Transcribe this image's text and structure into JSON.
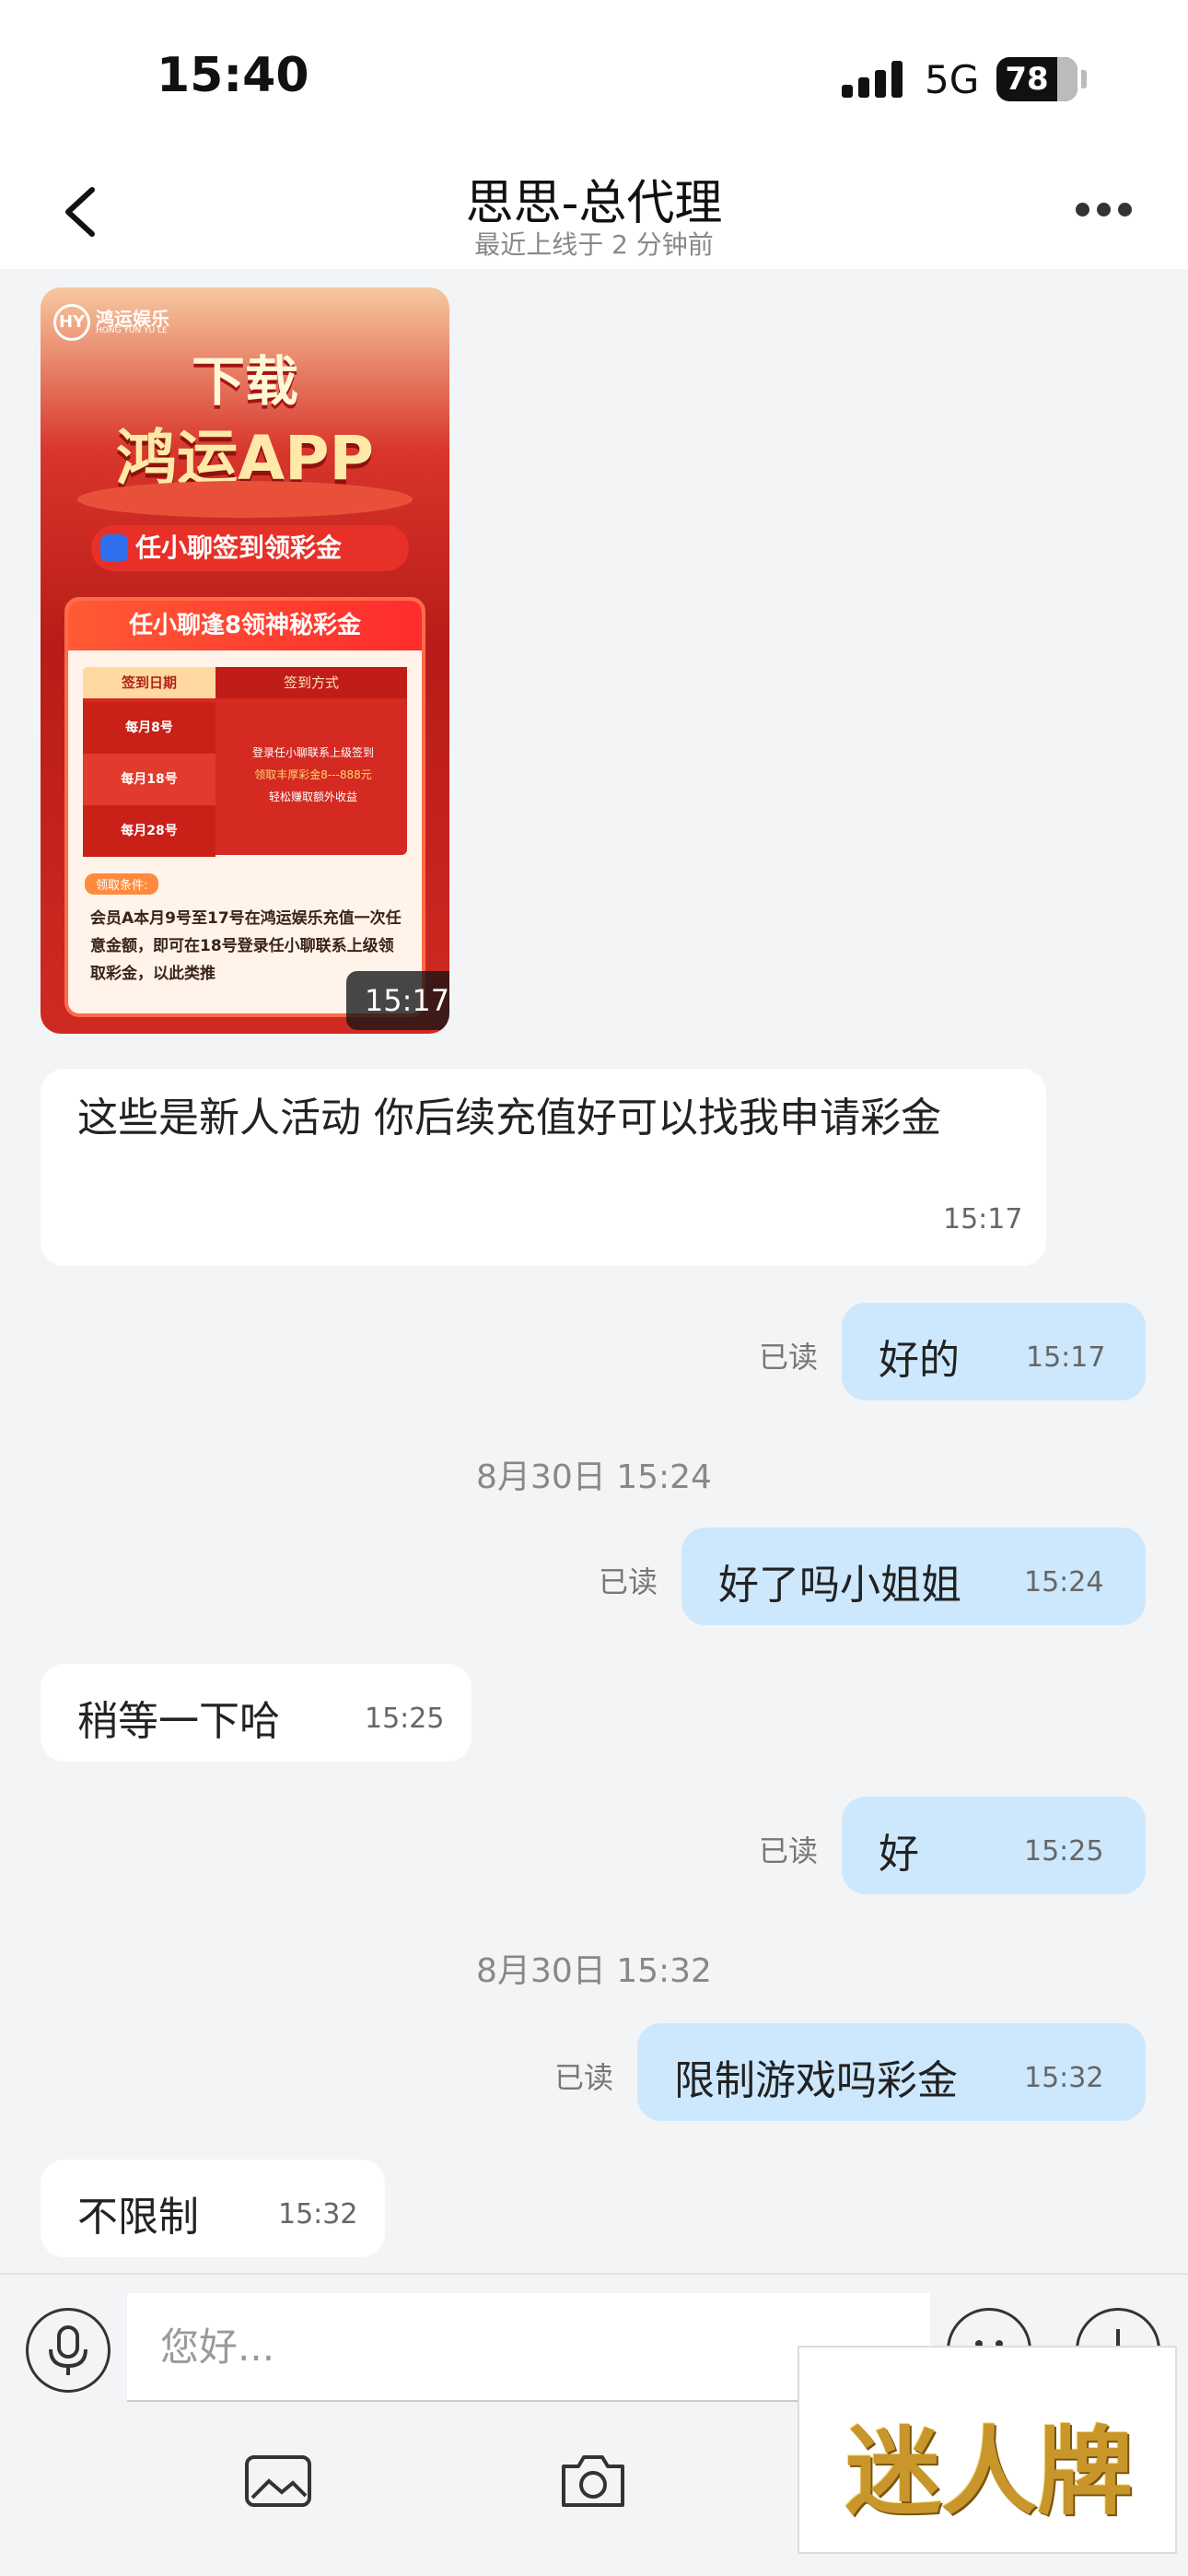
{
  "status_bar": {
    "time": "15:40",
    "network": "5G",
    "battery": "78"
  },
  "header": {
    "title": "思思-总代理",
    "subtitle": "最近上线于 2 分钟前"
  },
  "poster": {
    "brand": "鸿运娱乐",
    "brand_sub": "HONG YUN YU LE",
    "heading_line1": "下载",
    "heading_line2": "鸿运APP",
    "sign_banner": "任小聊签到领彩金",
    "card_title": "任小聊逢8领神秘彩金",
    "table_header_date": "签到日期",
    "table_header_method": "签到方式",
    "dates": [
      "每月8号",
      "每月18号",
      "每月28号"
    ],
    "method_line1": "登录任小聊联系上级签到",
    "method_line2": "领取丰厚彩金8---888元",
    "method_line3": "轻松赚取额外收益",
    "condition_tag": "领取条件:",
    "condition_text": "会员A本月9号至17号在鸿运娱乐充值一次任意金额，即可在18号登录任小聊联系上级领取彩金，以此类推",
    "time": "15:17"
  },
  "messages": [
    {
      "text": "这些是新人活动 你后续充值好可以找我申请彩金",
      "time": "15:17"
    },
    {
      "text": "好的",
      "time": "15:17",
      "read": "已读"
    },
    {
      "separator": "8月30日 15:24"
    },
    {
      "text": "好了吗小姐姐",
      "time": "15:24",
      "read": "已读"
    },
    {
      "text": "稍等一下哈",
      "time": "15:25"
    },
    {
      "text": "好",
      "time": "15:25",
      "read": "已读"
    },
    {
      "separator": "8月30日 15:32"
    },
    {
      "text": "限制游戏吗彩金",
      "time": "15:32",
      "read": "已读"
    },
    {
      "text": "不限制",
      "time": "15:32"
    }
  ],
  "input": {
    "placeholder": "您好..."
  },
  "watermark": "迷人牌"
}
